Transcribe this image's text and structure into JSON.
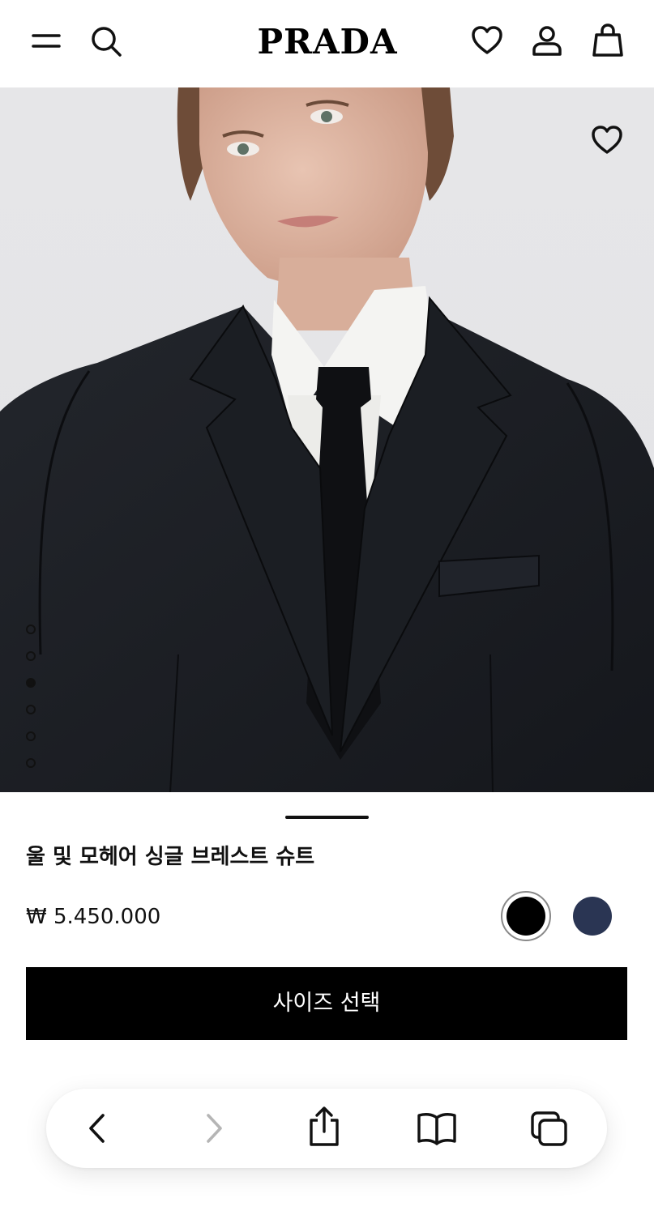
{
  "header": {
    "brand": "PRADA",
    "icons": [
      "menu-icon",
      "search-icon",
      "heart-icon",
      "account-icon",
      "bag-icon"
    ]
  },
  "gallery": {
    "image_count": 6,
    "active_index": 2,
    "wishlist_icon": "heart-icon"
  },
  "product": {
    "title": "울 및 모헤어 싱글 브레스트 슈트",
    "price": "₩ 5.450.000",
    "colors": [
      {
        "name": "black",
        "hex": "#000000",
        "selected": true
      },
      {
        "name": "navy",
        "hex": "#2a3553",
        "selected": false
      }
    ],
    "size_button_label": "사이즈 선택"
  },
  "browser_toolbar": {
    "icons": [
      "back-icon",
      "forward-icon",
      "share-icon",
      "bookmarks-icon",
      "tabs-icon"
    ],
    "forward_enabled": false
  },
  "colors": {
    "accent": "#000000",
    "background": "#ffffff",
    "hero_background": "#e4e4e7",
    "disabled_icon": "#b5b5b5"
  }
}
